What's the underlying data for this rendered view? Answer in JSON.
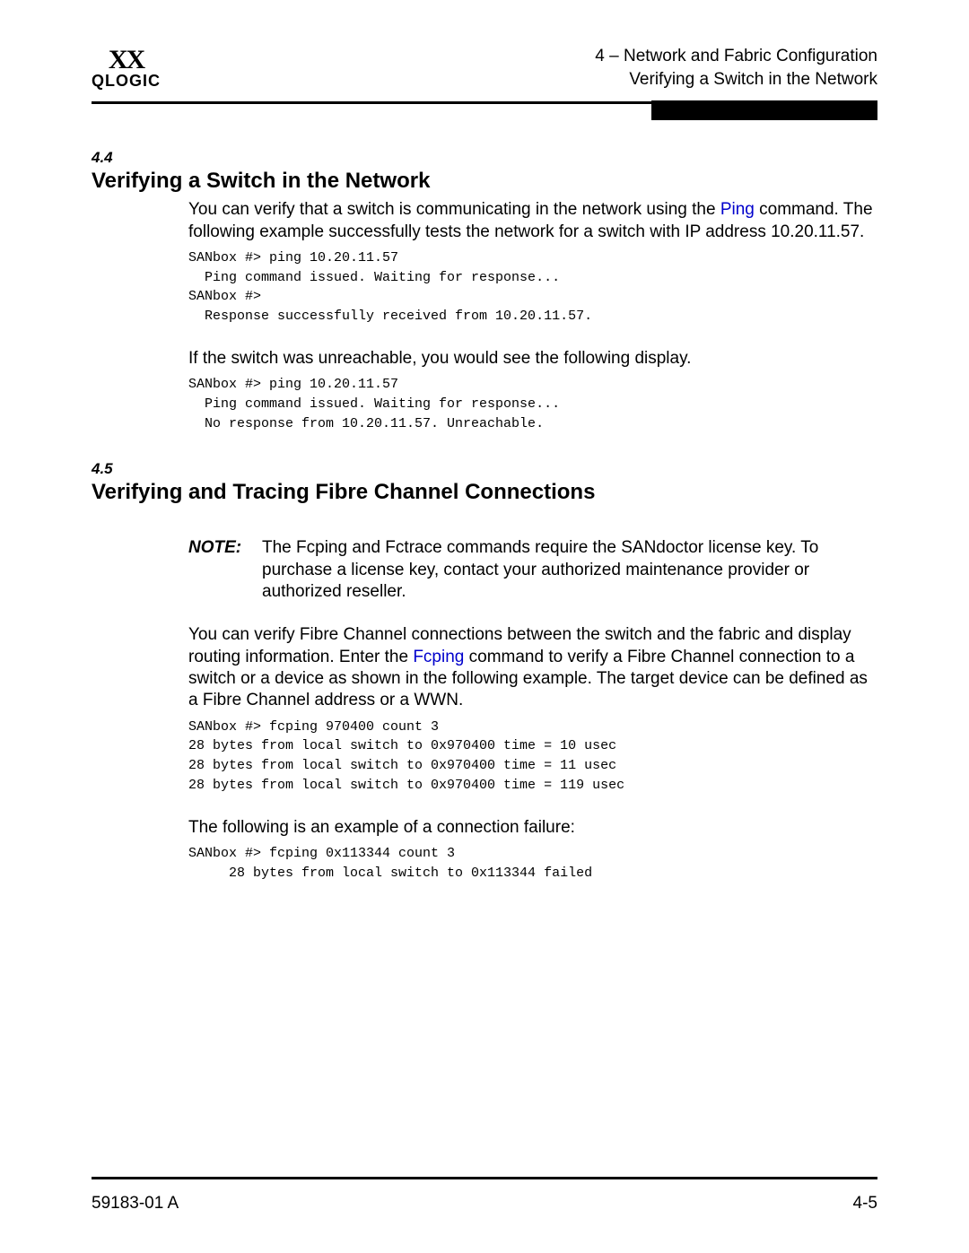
{
  "logo": {
    "glyph": "XX",
    "word": "QLOGIC"
  },
  "header": {
    "line1": "4 – Network and Fabric Configuration",
    "line2": "Verifying a Switch in the Network"
  },
  "sections": {
    "s44": {
      "num": "4.4",
      "title": "Verifying a Switch in the Network",
      "para1_pre": "You can verify that a switch is communicating in the network using the ",
      "para1_link": "Ping",
      "para1_post": " command. The following example successfully tests the network for a switch with IP address 10.20.11.57.",
      "code1": "SANbox #> ping 10.20.11.57\n  Ping command issued. Waiting for response...\nSANbox #>\n  Response successfully received from 10.20.11.57.",
      "para2": "If the switch was unreachable, you would see the following display.",
      "code2": "SANbox #> ping 10.20.11.57\n  Ping command issued. Waiting for response...\n  No response from 10.20.11.57. Unreachable."
    },
    "s45": {
      "num": "4.5",
      "title": "Verifying and Tracing Fibre Channel Connections",
      "note_label": "NOTE:",
      "note_text": "The Fcping and Fctrace commands require the SANdoctor license key. To purchase a license key, contact your authorized maintenance provider or authorized reseller.",
      "para1_pre": "You can verify Fibre Channel connections between the switch and the fabric and display routing information. Enter the ",
      "para1_link": "Fcping",
      "para1_post": " command to verify a Fibre Channel connection to a switch or a device as shown in the following example. The target device can be defined as a Fibre Channel address or a WWN.",
      "code1": "SANbox #> fcping 970400 count 3\n28 bytes from local switch to 0x970400 time = 10 usec\n28 bytes from local switch to 0x970400 time = 11 usec\n28 bytes from local switch to 0x970400 time = 119 usec",
      "para2": "The following is an example of a connection failure:",
      "code2": "SANbox #> fcping 0x113344 count 3\n     28 bytes from local switch to 0x113344 failed"
    }
  },
  "footer": {
    "left": "59183-01 A",
    "right": "4-5"
  }
}
